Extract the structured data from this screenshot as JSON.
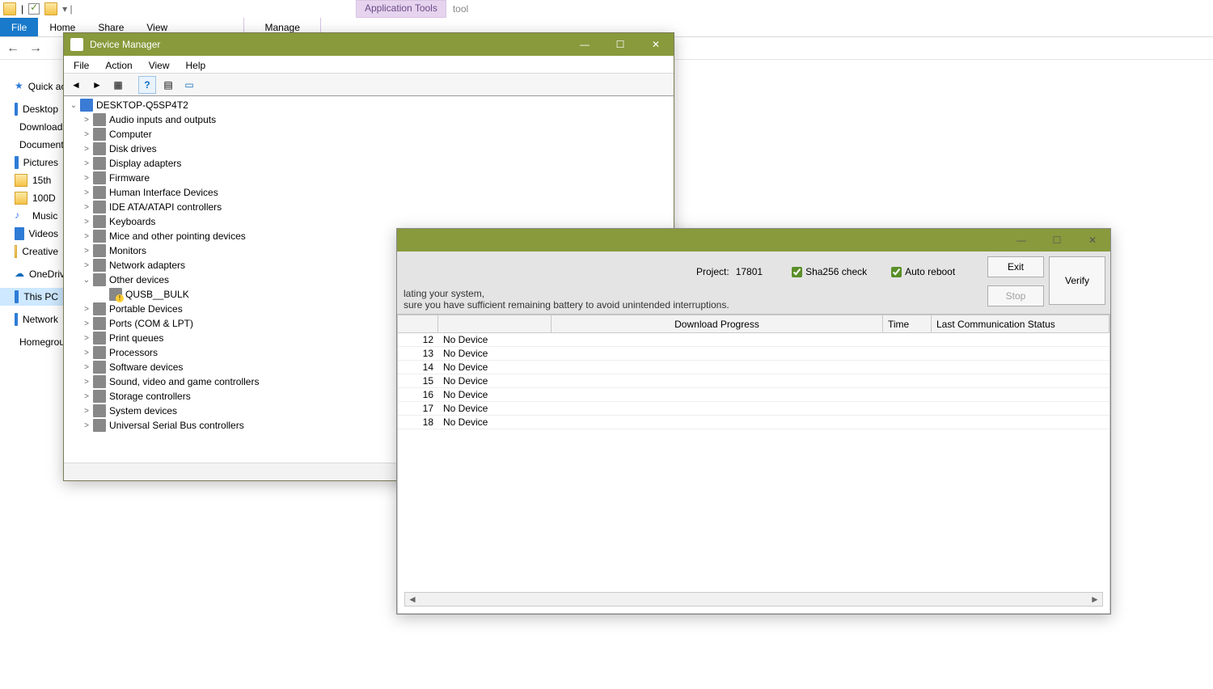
{
  "explorer": {
    "context_tab": "Application Tools",
    "address_hint": "tool",
    "ribbon": {
      "file": "File",
      "home": "Home",
      "share": "Share",
      "view": "View",
      "manage": "Manage"
    },
    "sidebar": [
      {
        "label": "Quick access",
        "ico": "star"
      },
      {
        "label": "Desktop",
        "ico": "drive"
      },
      {
        "label": "Downloads",
        "ico": "drive"
      },
      {
        "label": "Documents",
        "ico": "drive"
      },
      {
        "label": "Pictures",
        "ico": "drive"
      },
      {
        "label": "15th",
        "ico": "folder"
      },
      {
        "label": "100D",
        "ico": "folder"
      },
      {
        "label": "Music",
        "ico": "music"
      },
      {
        "label": "Videos",
        "ico": "drive"
      },
      {
        "label": "Creative",
        "ico": "folder"
      },
      {
        "label": "OneDrive",
        "ico": "cloud"
      },
      {
        "label": "This PC",
        "ico": "drive",
        "selected": true
      },
      {
        "label": "Network",
        "ico": "drive"
      },
      {
        "label": "Homegroup",
        "ico": "drive"
      }
    ]
  },
  "devmgr": {
    "title": "Device Manager",
    "menu": [
      "File",
      "Action",
      "View",
      "Help"
    ],
    "root": "DESKTOP-Q5SP4T2",
    "categories": [
      {
        "label": "Audio inputs and outputs"
      },
      {
        "label": "Computer"
      },
      {
        "label": "Disk drives"
      },
      {
        "label": "Display adapters"
      },
      {
        "label": "Firmware"
      },
      {
        "label": "Human Interface Devices"
      },
      {
        "label": "IDE ATA/ATAPI controllers"
      },
      {
        "label": "Keyboards"
      },
      {
        "label": "Mice and other pointing devices"
      },
      {
        "label": "Monitors"
      },
      {
        "label": "Network adapters"
      },
      {
        "label": "Other devices",
        "expanded": true,
        "children": [
          {
            "label": "QUSB__BULK",
            "warn": true
          }
        ]
      },
      {
        "label": "Portable Devices"
      },
      {
        "label": "Ports (COM & LPT)"
      },
      {
        "label": "Print queues"
      },
      {
        "label": "Processors"
      },
      {
        "label": "Software devices"
      },
      {
        "label": "Sound, video and game controllers"
      },
      {
        "label": "Storage controllers"
      },
      {
        "label": "System devices"
      },
      {
        "label": "Universal Serial Bus controllers"
      }
    ]
  },
  "flash": {
    "project_label": "Project:",
    "project_value": "17801",
    "sha_label": "Sha256 check",
    "reboot_label": "Auto reboot",
    "exit": "Exit",
    "stop": "Stop",
    "verify": "Verify",
    "note1": "lating your system,",
    "note2": "sure you have sufficient remaining battery to avoid unintended interruptions.",
    "headers": {
      "progress": "Download Progress",
      "time": "Time",
      "last": "Last Communication Status"
    },
    "rows": [
      {
        "n": "12",
        "dev": "No Device"
      },
      {
        "n": "13",
        "dev": "No Device"
      },
      {
        "n": "14",
        "dev": "No Device"
      },
      {
        "n": "15",
        "dev": "No Device"
      },
      {
        "n": "16",
        "dev": "No Device"
      },
      {
        "n": "17",
        "dev": "No Device"
      },
      {
        "n": "18",
        "dev": "No Device"
      }
    ]
  }
}
